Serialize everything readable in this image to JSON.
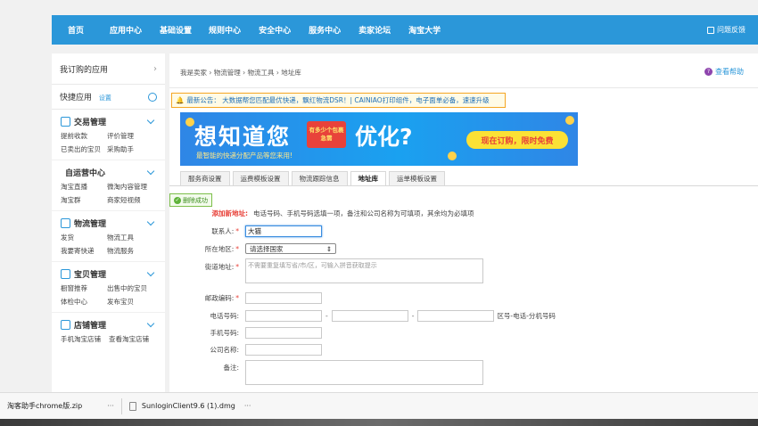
{
  "nav": {
    "items": [
      "首页",
      "应用中心",
      "基础设置",
      "规则中心",
      "安全中心",
      "服务中心",
      "卖家论坛",
      "淘宝大学"
    ],
    "feedback": "问题反馈"
  },
  "sidebar": {
    "my_apps": "我订购的应用",
    "quick_apps": "快捷应用",
    "quick_settings": "设置",
    "sections": [
      {
        "title": "交易管理",
        "icon": "document-icon",
        "links": [
          "提前收款",
          "评价管理",
          "已卖出的宝贝",
          "采购助手"
        ]
      },
      {
        "title": "自运营中心",
        "icon": "",
        "links": [
          "淘宝直播",
          "微淘内容管理",
          "淘宝群",
          "商家短视频"
        ]
      },
      {
        "title": "物流管理",
        "icon": "truck-icon",
        "links": [
          "发货",
          "物流工具",
          "我要寄快递",
          "物流服务"
        ]
      },
      {
        "title": "宝贝管理",
        "icon": "shirt-icon",
        "links": [
          "橱窗推荐",
          "出售中的宝贝",
          "体检中心",
          "发布宝贝"
        ]
      },
      {
        "title": "店铺管理",
        "icon": "shop-icon",
        "links": [
          "手机淘宝店铺",
          "查看淘宝店铺"
        ]
      }
    ]
  },
  "main": {
    "breadcrumb": "我是卖家 › 物流管理 › 物流工具 › 地址库",
    "help": "查看帮助",
    "notice": "最新公告：  大数据帮您匹配最优快递，飘红物流DSR！| CAINIAO打印组件，电子面单必备，速速升级",
    "banner": {
      "headline_a": "想知道您",
      "box_text": "有多少个包裹急需",
      "headline_b": "优化?",
      "subtitle": "最智能的快递分配产品等您来用!",
      "cta": "现在订购，限时免费"
    },
    "tabs": [
      "服务商设置",
      "运费模板设置",
      "物流跟踪信息",
      "地址库",
      "运单模板设置"
    ],
    "active_tab": "地址库",
    "delete_success": "删除成功"
  },
  "form": {
    "add_label": "添加新地址:",
    "add_note": "电话号码、手机号码选填一项，备注和公司名称为可填项，其余均为必填项",
    "contact_label": "联系人:",
    "contact_value": "大猫",
    "region_label": "所在地区:",
    "region_value": "请选择国家",
    "street_label": "街道地址:",
    "street_placeholder": "不需要重复填写省/市/区，可输入拼音获取提示",
    "zip_label": "邮政编码:",
    "phone_label": "电话号码:",
    "phone_hint": "区号-电话-分机号码",
    "mobile_label": "手机号码:",
    "company_label": "公司名称:",
    "remark_label": "备注:",
    "required_mark": "*"
  },
  "downloads": [
    {
      "name": "淘客助手chrome版.zip",
      "more": "···"
    },
    {
      "name": "SunloginClient9.6 (1).dmg",
      "more": "···"
    }
  ],
  "colors": {
    "brand": "#2b97d9",
    "alert": "#e8423a",
    "notice_border": "#f5a623",
    "success": "#5fb33a"
  }
}
